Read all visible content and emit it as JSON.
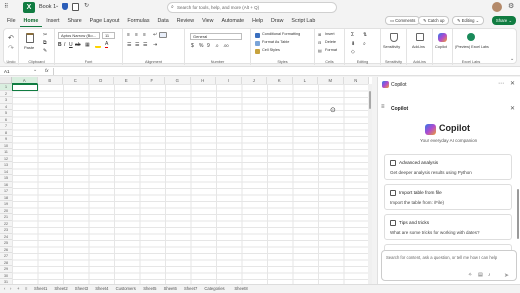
{
  "titlebar": {
    "autosave_label": "AutoSave",
    "filename": "Book 1",
    "search_placeholder": "Search for tools, help, and more (Alt + Q)"
  },
  "menu": {
    "tabs": [
      "File",
      "Home",
      "Insert",
      "Share",
      "Page Layout",
      "Formulas",
      "Data",
      "Review",
      "View",
      "Automate",
      "Help",
      "Draw",
      "Script Lab"
    ],
    "active": "Home",
    "comments": "Comments",
    "catchup": "Catch up",
    "editing": "Editing",
    "share": "Share"
  },
  "ribbon": {
    "undo_label": "Undo",
    "paste_label": "Paste",
    "clipboard_label": "Clipboard",
    "font_name": "Aptos Narrow (Bo...",
    "font_size": "11",
    "font_label": "Font",
    "alignment_label": "Alignment",
    "number_format": "General",
    "number_label": "Number",
    "conditional_formatting": "Conditional Formatting",
    "format_as_table": "Format As Table",
    "cell_styles": "Cell Styles",
    "styles_label": "Styles",
    "insert": "Insert",
    "delete": "Delete",
    "format": "Format",
    "cells_label": "Cells",
    "editing_label": "Editing",
    "sensitivity": "Sensitivity",
    "addins": "Add-ins",
    "copilot": "Copilot",
    "preview_excel_labs": "(Preview) Excel Labs",
    "excel_labs": "Excel Labs"
  },
  "formula_bar": {
    "cell_ref": "A1",
    "fx": "fx"
  },
  "grid": {
    "columns": [
      "A",
      "B",
      "C",
      "D",
      "E",
      "F",
      "G",
      "H",
      "I",
      "J",
      "K",
      "L",
      "M",
      "N"
    ],
    "rows": [
      "1",
      "2",
      "3",
      "4",
      "5",
      "6",
      "7",
      "8",
      "9",
      "10",
      "11",
      "12",
      "13",
      "14",
      "15",
      "16",
      "17",
      "18",
      "19",
      "20",
      "21",
      "22",
      "23",
      "24",
      "25",
      "26",
      "27",
      "28",
      "29",
      "30",
      "31"
    ]
  },
  "sheet_tabs": [
    "Sheet1",
    "Sheet2",
    "Sheet3",
    "Sheet4",
    "Customers",
    "Sheet5",
    "Sheet6",
    "Sheet7",
    "Categories",
    "Sheet8"
  ],
  "copilot_pane": {
    "header": "Copilot",
    "title": "Copilot",
    "brand": "Copilot",
    "tagline": "Your everyday AI companion",
    "cards": [
      {
        "title": "Advanced analysis",
        "desc": "Get deeper analysis results using Python"
      },
      {
        "title": "Import table from file",
        "desc": "Import the table from: /File)"
      },
      {
        "title": "Tips and tricks",
        "desc": "What are some tricks for working with dates?"
      }
    ],
    "input_placeholder": "Search for content, ask a question, or tell me how I can help",
    "char_count": "0/2000"
  }
}
